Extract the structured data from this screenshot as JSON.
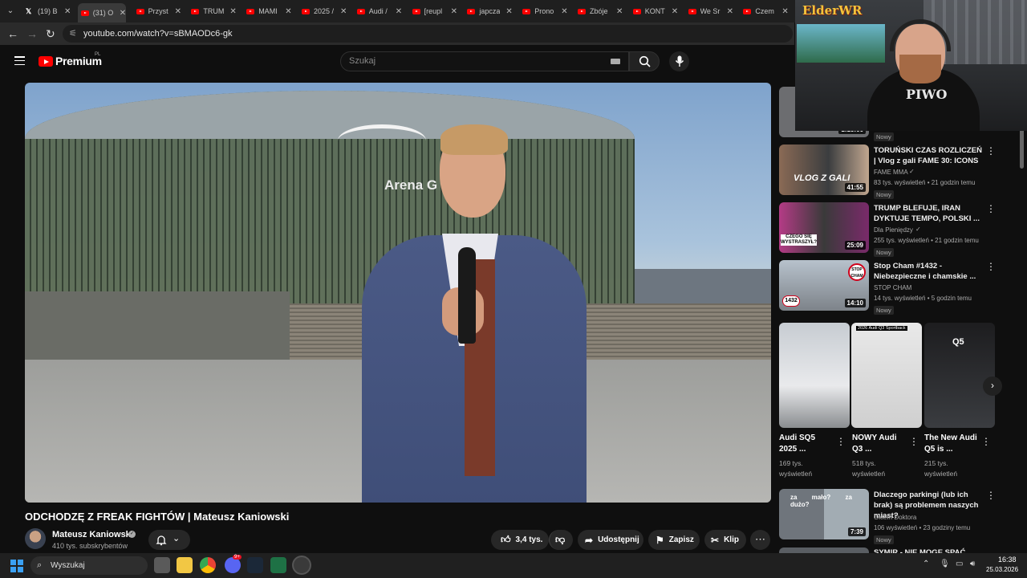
{
  "browser": {
    "tabs": [
      {
        "label": "(19) B",
        "icon": "x-icon"
      },
      {
        "label": "(31) O",
        "icon": "youtube-icon",
        "active": true
      },
      {
        "label": "Przyst",
        "icon": "youtube-icon"
      },
      {
        "label": "TRUM",
        "icon": "youtube-icon"
      },
      {
        "label": "MAMI",
        "icon": "youtube-icon"
      },
      {
        "label": "2025 /",
        "icon": "youtube-icon"
      },
      {
        "label": "Audi /",
        "icon": "youtube-icon"
      },
      {
        "label": "[reupl",
        "icon": "youtube-icon"
      },
      {
        "label": "japcza",
        "icon": "youtube-icon"
      },
      {
        "label": "Prono",
        "icon": "youtube-icon"
      },
      {
        "label": "Zbóje",
        "icon": "youtube-icon"
      },
      {
        "label": "KONT",
        "icon": "youtube-icon"
      },
      {
        "label": "We Sr",
        "icon": "youtube-icon"
      },
      {
        "label": "Czem",
        "icon": "youtube-icon"
      }
    ],
    "url": "youtube.com/watch?v=sBMAODc6-gk"
  },
  "youtube": {
    "logo_text": "Premium",
    "region": "PL",
    "search_placeholder": "Szukaj"
  },
  "video": {
    "title": "ODCHODZĘ Z FREAK FIGHTÓW | Mateusz Kaniowski",
    "scene_text": "Arena G",
    "channel": "Mateusz Kaniowski",
    "subscribers": "410 tys. subskrybentów",
    "likes": "3,4 tys.",
    "share_label": "Udostępnij",
    "save_label": "Zapisz",
    "clip_label": "Klip"
  },
  "recommended": [
    {
      "duration": "1:15:06",
      "new": "Nowy"
    },
    {
      "title": "TORUŃSKI CZAS ROZLICZEŃ | Vlog z gali FAME 30: ICONS",
      "channel": "FAME MMA",
      "verified": true,
      "meta": "83 tys. wyświetleń • 21 godzin temu",
      "duration": "41:55",
      "new": "Nowy",
      "thumb_text": "VLOG Z GALI"
    },
    {
      "title": "TRUMP BLEFUJE, IRAN DYKTUJE TEMPO, POLSKI ...",
      "channel": "Dla Pieniędzy",
      "verified": true,
      "meta": "255 tys. wyświetleń • 21 godzin temu",
      "duration": "25:09",
      "new": "Nowy",
      "thumb_text": "CZEGO SIĘ WYSTRASZYŁ?"
    },
    {
      "title": "Stop Cham #1432 - Niebezpieczne i chamskie ...",
      "channel": "STOP CHAM",
      "verified": false,
      "meta": "14 tys. wyświetleń • 5 godzin temu",
      "duration": "14:10",
      "new": "Nowy",
      "thumb_text": "1432"
    }
  ],
  "shorts": [
    {
      "title": "Audi SQ5 2025 ...",
      "views": "169 tys. wyświetleń"
    },
    {
      "title": "NOWY Audi Q3 ...",
      "views": "518 tys. wyświetleń",
      "thumb_text": "2026 Audi Q3 Sportback"
    },
    {
      "title": "The New Audi Q5 is ...",
      "views": "215 tys. wyświetleń",
      "thumb_text": "Q5"
    }
  ],
  "recommended_bottom": [
    {
      "title": "Dlaczego parkingi (lub ich brak) są problemem naszych miast?",
      "channel": "Okiem Doktora",
      "meta": "106 wyświetleń • 23 godziny temu",
      "duration": "7:39",
      "new": "Nowy",
      "thumb_text": "za mało? za dużo?"
    },
    {
      "title": "SYMIR - NIE MOGE SPAĆ ..."
    }
  ],
  "webcam": {
    "logo": "ElderWR",
    "shirt_text": "PIWO"
  },
  "taskbar": {
    "search_label": "Wyszukaj",
    "time": "16:38",
    "date": "25.03.2026",
    "badge": "9+"
  },
  "colors": {
    "background": "#0f0f0f",
    "youtube_red": "#ff0000",
    "pill": "#272727"
  }
}
